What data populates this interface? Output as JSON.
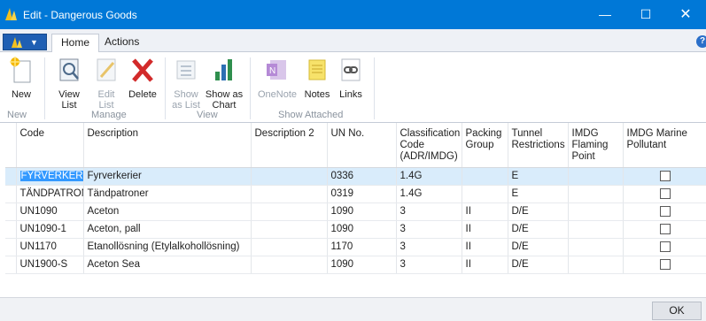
{
  "window": {
    "title": "Edit - Dangerous Goods",
    "controls": {
      "minimize": "—",
      "maximize": "☐",
      "close": "✕"
    }
  },
  "tabs": [
    {
      "label": "Home",
      "active": true
    },
    {
      "label": "Actions",
      "active": false
    }
  ],
  "ribbon": {
    "groups": [
      {
        "label": "New",
        "buttons": [
          {
            "label": "New",
            "icon": "new-document-icon",
            "enabled": true
          }
        ]
      },
      {
        "label": "Manage",
        "buttons": [
          {
            "label": "View List",
            "icon": "view-list-icon",
            "enabled": true
          },
          {
            "label": "Edit List",
            "icon": "edit-list-icon",
            "enabled": false
          },
          {
            "label": "Delete",
            "icon": "delete-x-icon",
            "enabled": true
          }
        ]
      },
      {
        "label": "View",
        "buttons": [
          {
            "label": "Show as List",
            "icon": "show-as-list-icon",
            "enabled": false
          },
          {
            "label": "Show as Chart",
            "icon": "show-as-chart-icon",
            "enabled": true
          }
        ]
      },
      {
        "label": "Show Attached",
        "buttons": [
          {
            "label": "OneNote",
            "icon": "onenote-icon",
            "enabled": false
          },
          {
            "label": "Notes",
            "icon": "notes-icon",
            "enabled": true
          },
          {
            "label": "Links",
            "icon": "links-icon",
            "enabled": true
          }
        ]
      }
    ],
    "view_list_lines": [
      "View",
      "List"
    ],
    "edit_list_lines": [
      "Edit",
      "List"
    ],
    "show_as_list_lines": [
      "Show",
      "as List"
    ],
    "show_as_chart_lines": [
      "Show as",
      "Chart"
    ]
  },
  "table": {
    "columns": [
      "Code",
      "Description",
      "Description 2",
      "UN No.",
      "Classification Code (ADR/IMDG)",
      "Packing Group",
      "Tunnel Restrictions",
      "IMDG Flaming Point",
      "IMDG Marine Pollutant"
    ],
    "rows": [
      {
        "code": "FYRVERKERI",
        "description": "Fyrverkerier",
        "description2": "",
        "un_no": "0336",
        "classification": "1.4G",
        "packing_group": "",
        "tunnel": "E",
        "flaming_point": "",
        "marine_pollutant": false,
        "selected": true
      },
      {
        "code": "TÄNDPATRON",
        "description": "Tändpatroner",
        "description2": "",
        "un_no": "0319",
        "classification": "1.4G",
        "packing_group": "",
        "tunnel": "E",
        "flaming_point": "",
        "marine_pollutant": false,
        "selected": false
      },
      {
        "code": "UN1090",
        "description": "Aceton",
        "description2": "",
        "un_no": "1090",
        "classification": "3",
        "packing_group": "II",
        "tunnel": "D/E",
        "flaming_point": "",
        "marine_pollutant": false,
        "selected": false
      },
      {
        "code": "UN1090-1",
        "description": "Aceton, pall",
        "description2": "",
        "un_no": "1090",
        "classification": "3",
        "packing_group": "II",
        "tunnel": "D/E",
        "flaming_point": "",
        "marine_pollutant": false,
        "selected": false
      },
      {
        "code": "UN1170",
        "description": "Etanollösning (Etylalkohollösning)",
        "description2": "",
        "un_no": "1170",
        "classification": "3",
        "packing_group": "II",
        "tunnel": "D/E",
        "flaming_point": "",
        "marine_pollutant": false,
        "selected": false
      },
      {
        "code": "UN1900-S",
        "description": "Aceton Sea",
        "description2": "",
        "un_no": "1090",
        "classification": "3",
        "packing_group": "II",
        "tunnel": "D/E",
        "flaming_point": "",
        "marine_pollutant": false,
        "selected": false
      }
    ]
  },
  "footer": {
    "ok_label": "OK"
  },
  "colors": {
    "titlebar": "#0078d7",
    "selection": "#d9ecfb",
    "highlight": "#3399ff"
  }
}
